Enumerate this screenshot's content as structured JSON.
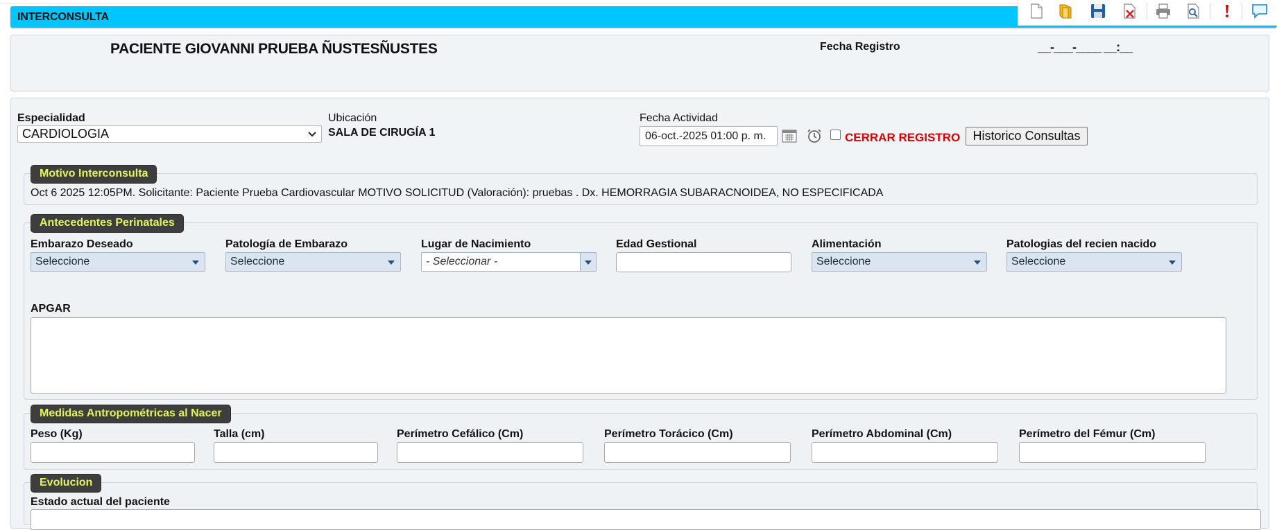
{
  "window": {
    "title": "INTERCONSULTA"
  },
  "toolbar": {
    "icons": [
      "new-document-icon",
      "open-folder-icon",
      "save-icon",
      "delete-document-icon",
      "print-icon",
      "print-preview-icon",
      "alert-icon",
      "chat-icon"
    ]
  },
  "patient": {
    "name": "PACIENTE GIOVANNI PRUEBA ÑUSTESÑUSTES",
    "fecha_registro_label": "Fecha Registro",
    "fecha_registro_value": "__-___-____ __:__"
  },
  "header": {
    "especialidad_label": "Especialidad",
    "especialidad_value": "CARDIOLOGIA",
    "ubicacion_label": "Ubicación",
    "ubicacion_value": "SALA DE CIRUGÍA 1",
    "fecha_actividad_label": "Fecha Actividad",
    "fecha_actividad_value": "06-oct.-2025 01:00 p. m.",
    "cerrar_registro_label": "CERRAR REGISTRO",
    "historico_button": "Historico Consultas"
  },
  "motivo": {
    "legend": "Motivo Interconsulta",
    "text": "Oct 6 2025 12:05PM. Solicitante: Paciente Prueba Cardiovascular MOTIVO SOLICITUD (Valoración): pruebas . Dx. HEMORRAGIA SUBARACNOIDEA, NO ESPECIFICADA"
  },
  "perinatales": {
    "legend": "Antecedentes Perinatales",
    "fields": [
      {
        "label": "Embarazo Deseado",
        "value": "Seleccione"
      },
      {
        "label": "Patología de Embarazo",
        "value": "Seleccione"
      },
      {
        "label": "Lugar de Nacimiento",
        "value": "- Seleccionar -"
      },
      {
        "label": "Edad Gestional",
        "value": ""
      },
      {
        "label": "Alimentación",
        "value": "Seleccione"
      },
      {
        "label": "Patologias del recien nacido",
        "value": "Seleccione"
      }
    ],
    "apgar_label": "APGAR"
  },
  "medidas": {
    "legend": "Medidas Antropométricas al Nacer",
    "fields": [
      {
        "label": "Peso (Kg)"
      },
      {
        "label": "Talla (cm)"
      },
      {
        "label": "Perímetro Cefálico (Cm)"
      },
      {
        "label": "Perímetro Torácico (Cm)"
      },
      {
        "label": "Perímetro Abdominal (Cm)"
      },
      {
        "label": "Perímetro del Fémur (Cm)"
      }
    ]
  },
  "evolucion": {
    "legend": "Evolucion",
    "estado_label": "Estado actual del paciente"
  },
  "colors": {
    "title_bar": "#00c6ff",
    "legend_bg": "#3e3e3e",
    "legend_text": "#e4f55a",
    "cerrar_text": "#e00000"
  }
}
